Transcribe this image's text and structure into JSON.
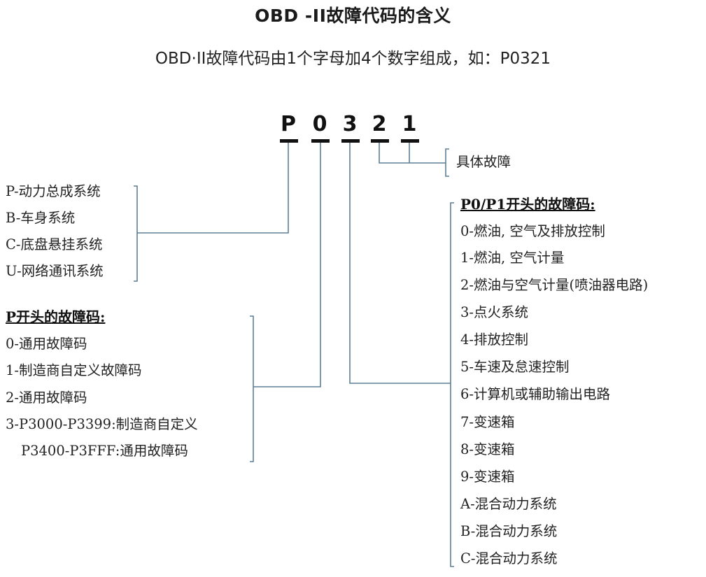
{
  "title": "OBD -II故障代码的含义",
  "subtitle": "OBD·II故障代码由1个字母加4个数字组成，如：P0321",
  "code": [
    "P",
    "0",
    "3",
    "2",
    "1"
  ],
  "specific_fault_label": "具体故障",
  "system_list": [
    "P-动力总成系统",
    "B-车身系统",
    "C-底盘悬挂系统",
    "U-网络通讯系统"
  ],
  "p_codes": {
    "heading": "P开头的故障码:",
    "items": [
      "0-通用故障码",
      "1-制造商自定义故障码",
      "2-通用故障码",
      "3-P3000-P3399:制造商自定义",
      "P3400-P3FFF:通用故障码"
    ]
  },
  "p0p1_codes": {
    "heading": "P0/P1开头的故障码:",
    "items": [
      "0-燃油, 空气及排放控制",
      "1-燃油, 空气计量",
      "2-燃油与空气计量(喷油器电路)",
      "3-点火系统",
      "4-排放控制",
      "5-车速及怠速控制",
      "6-计算机或辅助输出电路",
      "7-变速箱",
      "8-变速箱",
      "9-变速箱",
      "A-混合动力系统",
      "B-混合动力系统",
      "C-混合动力系统"
    ]
  },
  "colors": {
    "connector": "#5d7f96",
    "text": "#222222"
  }
}
